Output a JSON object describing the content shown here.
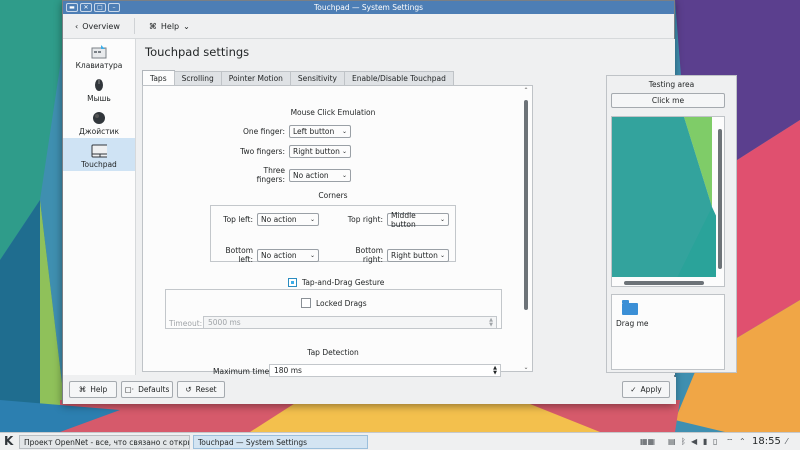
{
  "window": {
    "title": "Touchpad — System Settings",
    "toolbar": {
      "overview_label": "Overview",
      "help_label": "Help"
    }
  },
  "sidebar": {
    "items": [
      {
        "label": "Клавиатура",
        "icon": "keyboard-icon"
      },
      {
        "label": "Мышь",
        "icon": "mouse-icon"
      },
      {
        "label": "Джойстик",
        "icon": "joystick-icon"
      },
      {
        "label": "Touchpad",
        "icon": "touchpad-icon"
      }
    ]
  },
  "page": {
    "title": "Touchpad settings"
  },
  "tabs": [
    "Taps",
    "Scrolling",
    "Pointer Motion",
    "Sensitivity",
    "Enable/Disable Touchpad"
  ],
  "taps": {
    "mouse_click_emulation": {
      "heading": "Mouse Click Emulation",
      "one_finger": {
        "label": "One finger:",
        "value": "Left button"
      },
      "two_fingers": {
        "label": "Two fingers:",
        "value": "Right button"
      },
      "three_fingers": {
        "label": "Three fingers:",
        "value": "No action"
      }
    },
    "corners": {
      "heading": "Corners",
      "top_left": {
        "label": "Top left:",
        "value": "No action"
      },
      "top_right": {
        "label": "Top right:",
        "value": "Middle button"
      },
      "bottom_left": {
        "label": "Bottom left:",
        "value": "No action"
      },
      "bottom_right": {
        "label": "Bottom right:",
        "value": "Right button"
      }
    },
    "tap_and_drag": {
      "label": "Tap-and-Drag Gesture",
      "checked": true
    },
    "locked_drags": {
      "label": "Locked Drags",
      "checked": false
    },
    "timeout": {
      "label": "Timeout:",
      "value": "5000 ms"
    },
    "tap_detection": {
      "heading": "Tap Detection",
      "maximum_time": {
        "label": "Maximum time:",
        "value": "180 ms"
      }
    }
  },
  "testing_area": {
    "heading": "Testing area",
    "click_me": "Click me",
    "drag_me": "Drag me"
  },
  "buttons": {
    "help": "Help",
    "defaults": "Defaults",
    "reset": "Reset",
    "apply": "Apply"
  },
  "taskbar": {
    "tasks": [
      "Проект OpenNet - все, что связано с открыт...",
      "Touchpad — System Settings"
    ],
    "clock": "18:55"
  },
  "colors": {
    "accent": "#3daee9",
    "titlebar": "#4d7eb5",
    "selection": "#cfe3f4"
  }
}
